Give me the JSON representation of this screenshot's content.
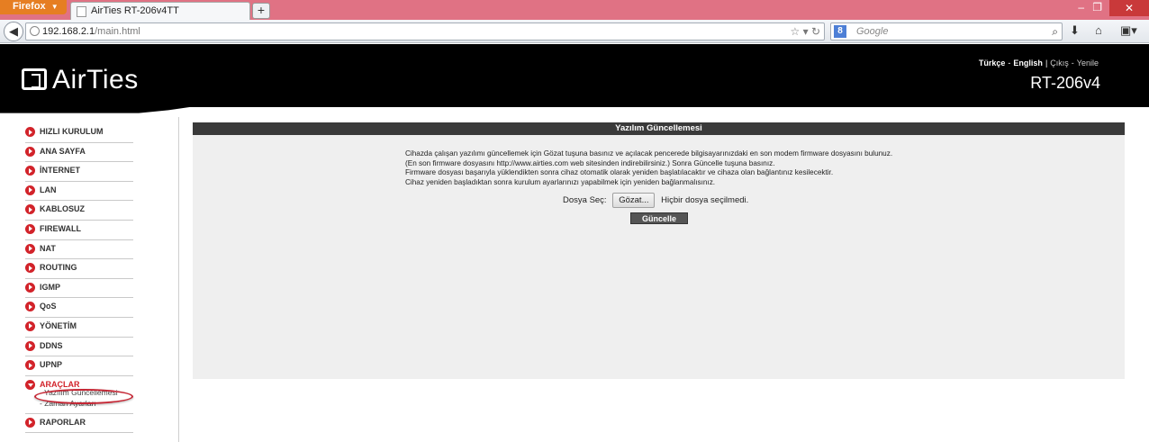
{
  "browser": {
    "menu_label": "Firefox",
    "tab_title": "AirTies RT-206v4TT",
    "new_tab": "+",
    "url_host": "192.168.2.1",
    "url_path": "/main.html",
    "search_placeholder": "Google",
    "search_engine": "8",
    "close_symbol": "✕",
    "min_symbol": "–",
    "max_symbol": "❐"
  },
  "header": {
    "logo_text": "AirTies",
    "lang_tr": "Türkçe",
    "lang_en": "English",
    "logout": "Çıkış",
    "refresh": "Yenile",
    "model": "RT-206v4"
  },
  "sidebar": {
    "items": [
      {
        "label": "HIZLI KURULUM"
      },
      {
        "label": "ANA SAYFA"
      },
      {
        "label": "İNTERNET"
      },
      {
        "label": "LAN"
      },
      {
        "label": "KABLOSUZ"
      },
      {
        "label": "FIREWALL"
      },
      {
        "label": "NAT"
      },
      {
        "label": "ROUTING"
      },
      {
        "label": "IGMP"
      },
      {
        "label": "QoS"
      },
      {
        "label": "YÖNETİM"
      },
      {
        "label": "DDNS"
      },
      {
        "label": "UPNP"
      }
    ],
    "open_item": "ARAÇLAR",
    "subitems": [
      "- Yazılım Güncellemesi",
      "- Zaman Ayarları"
    ],
    "last_item": "RAPORLAR"
  },
  "panel": {
    "title": "Yazılım Güncellemesi",
    "lines": [
      "Cihazda çalışan yazılımı güncellemek için Gözat tuşuna basınız ve açılacak pencerede bilgisayarınızdaki en son modem firmware dosyasını bulunuz.",
      "(En son firmware dosyasını http://www.airties.com web sitesinden indirebilirsiniz.) Sonra Güncelle tuşuna basınız.",
      "Firmware dosyası başarıyla yüklendikten sonra cihaz otomatik olarak yeniden başlatılacaktır ve cihaza olan bağlantınız kesilecektir.",
      "Cihaz yeniden başladıktan sonra kurulum ayarlarınızı yapabilmek için yeniden bağlanmalısınız."
    ],
    "file_label": "Dosya Seç:",
    "browse_button": "Gözat...",
    "no_file": "Hiçbir dosya seçilmedi.",
    "update_button": "Güncelle"
  }
}
